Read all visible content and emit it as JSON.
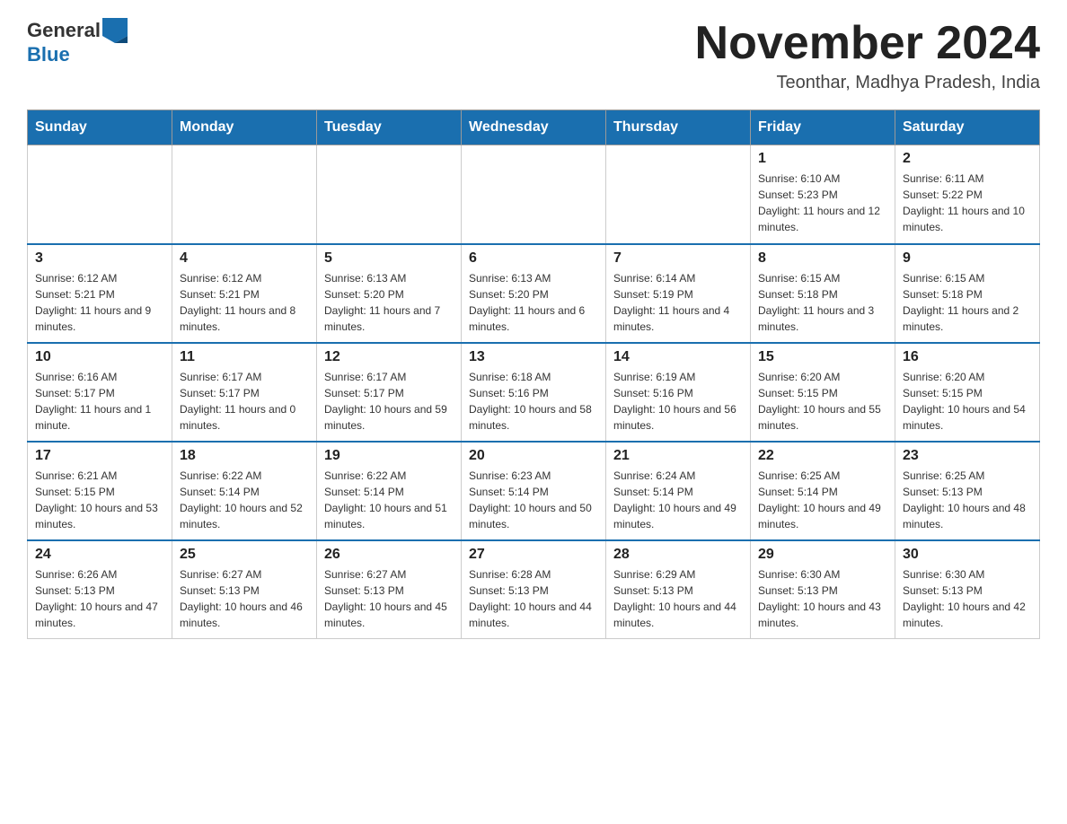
{
  "header": {
    "logo": {
      "general": "General",
      "blue": "Blue",
      "aria": "GeneralBlue logo"
    },
    "month_title": "November 2024",
    "location": "Teonthar, Madhya Pradesh, India"
  },
  "weekdays": [
    "Sunday",
    "Monday",
    "Tuesday",
    "Wednesday",
    "Thursday",
    "Friday",
    "Saturday"
  ],
  "weeks": [
    [
      {
        "day": "",
        "info": ""
      },
      {
        "day": "",
        "info": ""
      },
      {
        "day": "",
        "info": ""
      },
      {
        "day": "",
        "info": ""
      },
      {
        "day": "",
        "info": ""
      },
      {
        "day": "1",
        "info": "Sunrise: 6:10 AM\nSunset: 5:23 PM\nDaylight: 11 hours and 12 minutes."
      },
      {
        "day": "2",
        "info": "Sunrise: 6:11 AM\nSunset: 5:22 PM\nDaylight: 11 hours and 10 minutes."
      }
    ],
    [
      {
        "day": "3",
        "info": "Sunrise: 6:12 AM\nSunset: 5:21 PM\nDaylight: 11 hours and 9 minutes."
      },
      {
        "day": "4",
        "info": "Sunrise: 6:12 AM\nSunset: 5:21 PM\nDaylight: 11 hours and 8 minutes."
      },
      {
        "day": "5",
        "info": "Sunrise: 6:13 AM\nSunset: 5:20 PM\nDaylight: 11 hours and 7 minutes."
      },
      {
        "day": "6",
        "info": "Sunrise: 6:13 AM\nSunset: 5:20 PM\nDaylight: 11 hours and 6 minutes."
      },
      {
        "day": "7",
        "info": "Sunrise: 6:14 AM\nSunset: 5:19 PM\nDaylight: 11 hours and 4 minutes."
      },
      {
        "day": "8",
        "info": "Sunrise: 6:15 AM\nSunset: 5:18 PM\nDaylight: 11 hours and 3 minutes."
      },
      {
        "day": "9",
        "info": "Sunrise: 6:15 AM\nSunset: 5:18 PM\nDaylight: 11 hours and 2 minutes."
      }
    ],
    [
      {
        "day": "10",
        "info": "Sunrise: 6:16 AM\nSunset: 5:17 PM\nDaylight: 11 hours and 1 minute."
      },
      {
        "day": "11",
        "info": "Sunrise: 6:17 AM\nSunset: 5:17 PM\nDaylight: 11 hours and 0 minutes."
      },
      {
        "day": "12",
        "info": "Sunrise: 6:17 AM\nSunset: 5:17 PM\nDaylight: 10 hours and 59 minutes."
      },
      {
        "day": "13",
        "info": "Sunrise: 6:18 AM\nSunset: 5:16 PM\nDaylight: 10 hours and 58 minutes."
      },
      {
        "day": "14",
        "info": "Sunrise: 6:19 AM\nSunset: 5:16 PM\nDaylight: 10 hours and 56 minutes."
      },
      {
        "day": "15",
        "info": "Sunrise: 6:20 AM\nSunset: 5:15 PM\nDaylight: 10 hours and 55 minutes."
      },
      {
        "day": "16",
        "info": "Sunrise: 6:20 AM\nSunset: 5:15 PM\nDaylight: 10 hours and 54 minutes."
      }
    ],
    [
      {
        "day": "17",
        "info": "Sunrise: 6:21 AM\nSunset: 5:15 PM\nDaylight: 10 hours and 53 minutes."
      },
      {
        "day": "18",
        "info": "Sunrise: 6:22 AM\nSunset: 5:14 PM\nDaylight: 10 hours and 52 minutes."
      },
      {
        "day": "19",
        "info": "Sunrise: 6:22 AM\nSunset: 5:14 PM\nDaylight: 10 hours and 51 minutes."
      },
      {
        "day": "20",
        "info": "Sunrise: 6:23 AM\nSunset: 5:14 PM\nDaylight: 10 hours and 50 minutes."
      },
      {
        "day": "21",
        "info": "Sunrise: 6:24 AM\nSunset: 5:14 PM\nDaylight: 10 hours and 49 minutes."
      },
      {
        "day": "22",
        "info": "Sunrise: 6:25 AM\nSunset: 5:14 PM\nDaylight: 10 hours and 49 minutes."
      },
      {
        "day": "23",
        "info": "Sunrise: 6:25 AM\nSunset: 5:13 PM\nDaylight: 10 hours and 48 minutes."
      }
    ],
    [
      {
        "day": "24",
        "info": "Sunrise: 6:26 AM\nSunset: 5:13 PM\nDaylight: 10 hours and 47 minutes."
      },
      {
        "day": "25",
        "info": "Sunrise: 6:27 AM\nSunset: 5:13 PM\nDaylight: 10 hours and 46 minutes."
      },
      {
        "day": "26",
        "info": "Sunrise: 6:27 AM\nSunset: 5:13 PM\nDaylight: 10 hours and 45 minutes."
      },
      {
        "day": "27",
        "info": "Sunrise: 6:28 AM\nSunset: 5:13 PM\nDaylight: 10 hours and 44 minutes."
      },
      {
        "day": "28",
        "info": "Sunrise: 6:29 AM\nSunset: 5:13 PM\nDaylight: 10 hours and 44 minutes."
      },
      {
        "day": "29",
        "info": "Sunrise: 6:30 AM\nSunset: 5:13 PM\nDaylight: 10 hours and 43 minutes."
      },
      {
        "day": "30",
        "info": "Sunrise: 6:30 AM\nSunset: 5:13 PM\nDaylight: 10 hours and 42 minutes."
      }
    ]
  ]
}
